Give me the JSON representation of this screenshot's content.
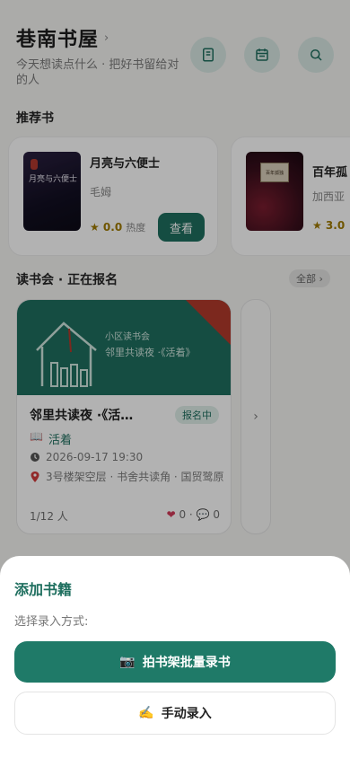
{
  "header": {
    "title": "巷南书屋",
    "title_chevron": "›",
    "tagline": "今天想读点什么 · 把好书留给对的人",
    "icons": [
      "book-icon",
      "calendar-icon",
      "search-icon"
    ]
  },
  "recommended": {
    "section_title": "推荐书",
    "books": [
      {
        "cover_text": "月亮与六便士",
        "title": "月亮与六便士",
        "author": "毛姆",
        "rating": "★ 0.0",
        "hot_label": "热度",
        "action": "查看"
      },
      {
        "cover_text": "百年孤独",
        "title": "百年孤",
        "author": "加西亚",
        "rating": "★ 3.0"
      }
    ]
  },
  "clubs": {
    "section_title": "读书会 · 正在报名",
    "all_label": "全部 ›",
    "event": {
      "banner_small": "小区读书会",
      "banner_main": "邻里共读夜 ·《活着》",
      "title": "邻里共读夜 ·《活…",
      "status": "报名中",
      "book_icon": "📖",
      "book": "活着",
      "time": "2026-09-17 19:30",
      "location": "3号楼架空层 · 书舍共读角 · 国贸鹭原",
      "capacity": "1/12 人",
      "likes": "0",
      "comments": "0",
      "separator": "·",
      "heart": "❤",
      "comment_icon": "💬"
    },
    "next_label": "›"
  },
  "sheet": {
    "title": "添加书籍",
    "subtitle": "选择录入方式:",
    "primary_icon": "📷",
    "primary_label": "拍书架批量录书",
    "secondary_icon": "✍️",
    "secondary_label": "手动录入"
  },
  "colors": {
    "accent": "#1f6f5f",
    "status_bg": "#dfeee9",
    "banner_triangle": "#b23a2b",
    "rating": "#a07a00"
  }
}
